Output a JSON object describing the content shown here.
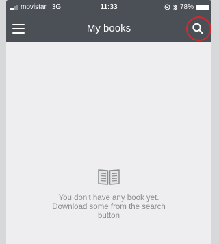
{
  "status_bar": {
    "carrier": "movistar",
    "network": "3G",
    "time": "11:33",
    "battery": "78%"
  },
  "nav_bar": {
    "title": "My books",
    "menu_icon": "hamburger-menu-icon",
    "search_icon": "search-icon"
  },
  "empty_state": {
    "icon": "open-book-icon",
    "message": "You don't have any book yet. Download some from the search button"
  },
  "colors": {
    "bar_background": "#4b5057",
    "content_background": "#eeeef0",
    "empty_text": "#8b8d90",
    "highlight_ring": "#d8282e"
  }
}
